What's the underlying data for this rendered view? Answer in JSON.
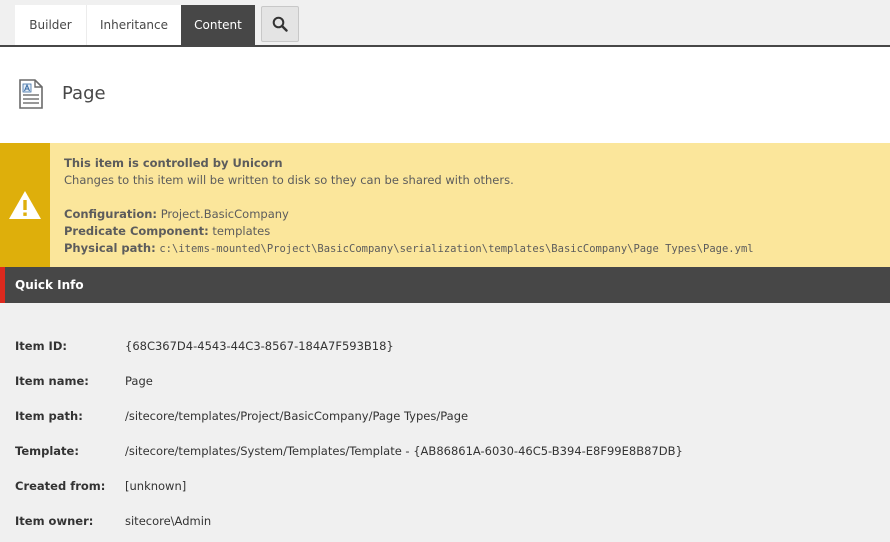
{
  "tabs": [
    {
      "label": "Builder"
    },
    {
      "label": "Inheritance"
    },
    {
      "label": "Content"
    }
  ],
  "header": {
    "title": "Page"
  },
  "warning": {
    "title": "This item is controlled by Unicorn",
    "message": "Changes to this item will be written to disk so they can be shared with others.",
    "configuration_label": "Configuration:",
    "configuration_value": "Project.BasicCompany",
    "predicate_label": "Predicate Component:",
    "predicate_value": "templates",
    "path_label": "Physical path:",
    "path_value": "c:\\items-mounted\\Project\\BasicCompany\\serialization\\templates\\BasicCompany\\Page Types\\Page.yml"
  },
  "quick_info": {
    "title": "Quick Info",
    "rows": [
      {
        "label": "Item ID:",
        "value": "{68C367D4-4543-44C3-8567-184A7F593B18}"
      },
      {
        "label": "Item name:",
        "value": "Page"
      },
      {
        "label": "Item path:",
        "value": "/sitecore/templates/Project/BasicCompany/Page Types/Page"
      },
      {
        "label": "Template:",
        "value": "/sitecore/templates/System/Templates/Template - {AB86861A-6030-46C5-B394-E8F99E8B87DB}"
      },
      {
        "label": "Created from:",
        "value": "[unknown]"
      },
      {
        "label": "Item owner:",
        "value": "sitecore\\Admin"
      }
    ]
  },
  "colors": {
    "dark": "#474747",
    "warning_bg": "#fbe69b",
    "warning_accent": "#deaf0b",
    "section_accent": "#dc291e"
  }
}
